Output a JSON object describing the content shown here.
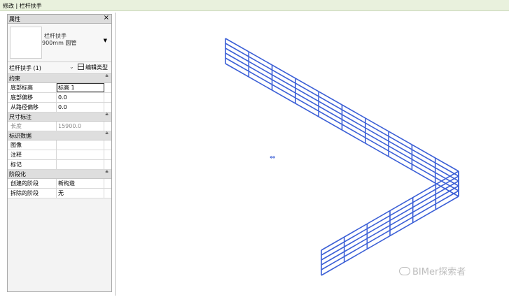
{
  "context_bar": {
    "label": "修改 | 栏杆扶手"
  },
  "properties": {
    "title": "属性",
    "close": "×",
    "type_selector": {
      "family": "栏杆扶手",
      "type": "900mm 圆管"
    },
    "instance_filter": "栏杆扶手 (1)",
    "edit_type_label": "编辑类型",
    "groups": [
      {
        "label": "约束",
        "rows": [
          {
            "key": "底部标高",
            "value": "标高 1"
          },
          {
            "key": "底部偏移",
            "value": "0.0"
          },
          {
            "key": "从路径偏移",
            "value": "0.0"
          }
        ]
      },
      {
        "label": "尺寸标注",
        "rows": [
          {
            "key": "长度",
            "value": "15900.0"
          }
        ]
      },
      {
        "label": "标识数据",
        "rows": [
          {
            "key": "图像",
            "value": ""
          },
          {
            "key": "注释",
            "value": ""
          },
          {
            "key": "标记",
            "value": ""
          }
        ]
      },
      {
        "label": "阶段化",
        "rows": [
          {
            "key": "创建的阶段",
            "value": "新构造"
          },
          {
            "key": "拆除的阶段",
            "value": "无"
          }
        ]
      }
    ]
  },
  "viewport": {
    "railing_color": "#3b5fd6",
    "watermark": "BIMer探索者"
  }
}
